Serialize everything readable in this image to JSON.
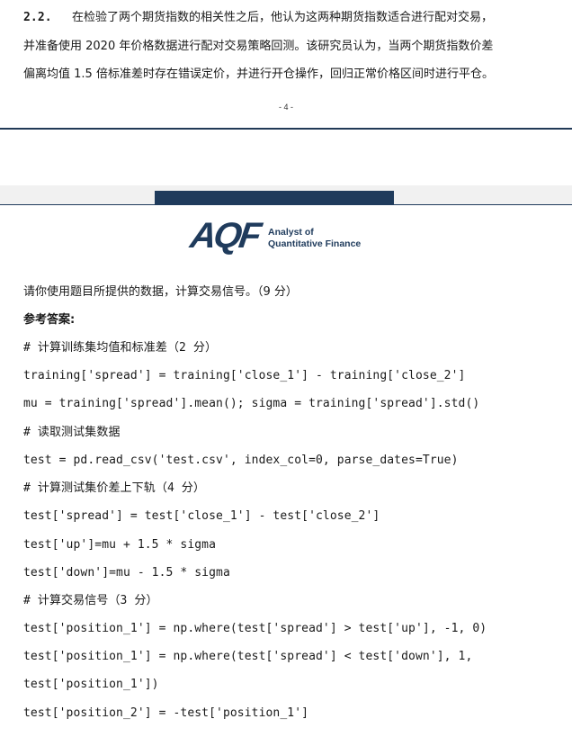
{
  "prev_page": {
    "item_number": "2.2.",
    "paragraph_lines": [
      "在检验了两个期货指数的相关性之后，他认为这两种期货指数适合进行配对交易，",
      "并准备使用 2020 年价格数据进行配对交易策略回测。该研究员认为，当两个期货指数价差",
      "偏离均值 1.5 倍标准差时存在错误定价，并进行开仓操作，回归正常价格区间时进行平仓。"
    ],
    "page_number": "- 4 -"
  },
  "logo": {
    "mark": "AQF",
    "line1": "Analyst of",
    "line2": "Quantitative Finance"
  },
  "question": "请你使用题目所提供的数据，计算交易信号。（9 分）",
  "answer_heading": "参考答案:",
  "code_lines": [
    "# 计算训练集均值和标准差（2 分）",
    "training['spread'] = training['close_1'] - training['close_2']",
    "mu = training['spread'].mean(); sigma = training['spread'].std()",
    "# 读取测试集数据",
    "test = pd.read_csv('test.csv', index_col=0, parse_dates=True)",
    "# 计算测试集价差上下轨（4 分）",
    "test['spread'] = test['close_1'] - test['close_2']",
    "test['up']=mu + 1.5 * sigma",
    "test['down']=mu - 1.5 * sigma",
    "# 计算交易信号（3 分）",
    "test['position_1'] = np.where(test['spread'] > test['up'], -1, 0)",
    "test['position_1']   =   np.where(test['spread']   <   test['down'],   1,",
    "test['position_1'])",
    "test['position_2'] = -test['position_1']"
  ],
  "colors": {
    "brand_navy": "#1f3b5c",
    "text": "#1a1a1a"
  }
}
